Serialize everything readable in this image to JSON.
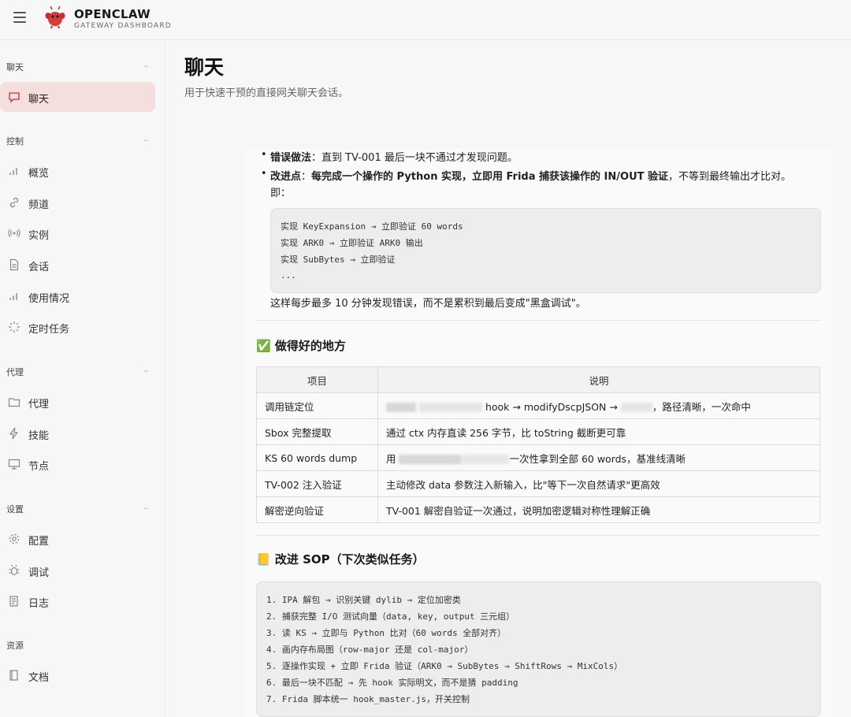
{
  "header": {
    "brand_title": "OPENCLAW",
    "brand_subtitle": "GATEWAY DASHBOARD"
  },
  "sidebar": {
    "sections": [
      {
        "title": "聊天",
        "items": [
          {
            "label": "聊天",
            "icon": "chat-icon",
            "active": true
          }
        ]
      },
      {
        "title": "控制",
        "items": [
          {
            "label": "概览",
            "icon": "bar-chart-icon"
          },
          {
            "label": "频道",
            "icon": "link-icon"
          },
          {
            "label": "实例",
            "icon": "broadcast-icon"
          },
          {
            "label": "会话",
            "icon": "document-icon"
          },
          {
            "label": "使用情况",
            "icon": "bar-chart-icon"
          },
          {
            "label": "定时任务",
            "icon": "loader-icon"
          }
        ]
      },
      {
        "title": "代理",
        "items": [
          {
            "label": "代理",
            "icon": "folder-icon"
          },
          {
            "label": "技能",
            "icon": "bolt-icon"
          },
          {
            "label": "节点",
            "icon": "monitor-icon"
          }
        ]
      },
      {
        "title": "设置",
        "items": [
          {
            "label": "配置",
            "icon": "gear-icon"
          },
          {
            "label": "调试",
            "icon": "bug-icon"
          },
          {
            "label": "日志",
            "icon": "log-icon"
          }
        ]
      },
      {
        "title": "资源",
        "items": [
          {
            "label": "文档",
            "icon": "book-icon"
          }
        ]
      }
    ],
    "collapse_symbol": "–"
  },
  "main": {
    "title": "聊天",
    "subtitle": "用于快速干预的直接网关聊天会话。"
  },
  "message": {
    "bullet1_label": "错误做法",
    "bullet1_text": "：直到 TV-001 最后一块不通过才发现问题。",
    "bullet2_label": "改进点",
    "bullet2_sep": "：",
    "bullet2_bold": "每完成一个操作的 Python 实现，立即用 Frida 捕获该操作的 IN/OUT 验证",
    "bullet2_rest": "，不等到最终输出才比对。",
    "bullet2_cont": "即：",
    "code1": [
      "实现 KeyExpansion → 立即验证 60 words",
      "实现 ARK0 → 立即验证 ARK0 输出",
      "实现 SubBytes → 立即验证",
      "..."
    ],
    "after_code": "这样每步最多 10 分钟发现错误，而不是累积到最后变成\"黑盒调试\"。",
    "heading_good": "✅ 做得好的地方",
    "table": {
      "headers": [
        "项目",
        "说明"
      ],
      "rows": [
        [
          "调用链定位",
          "hook → modifyDscpJSON → ",
          "，路径清晰，一次命中"
        ],
        [
          "Sbox 完整提取",
          "通过 ctx 内存直读 256 字节，比 toString 截断更可靠"
        ],
        [
          "KS 60 words dump",
          "用 ",
          "一次性拿到全部 60 words，基准线清晰"
        ],
        [
          "TV-002 注入验证",
          "主动修改 data 参数注入新输入，比\"等下一次自然请求\"更高效"
        ],
        [
          "解密逆向验证",
          "TV-001 解密自验证一次通过，说明加密逻辑对称性理解正确"
        ]
      ]
    },
    "heading_sop": "📒 改进 SOP（下次类似任务）",
    "code2": [
      "1. IPA 解包 → 识别关键 dylib → 定位加密类",
      "2. 捕获完整 I/O 测试向量（data, key, output 三元组）",
      "3. 读 KS → 立即与 Python 比对（60 words 全部对齐）",
      "4. 画内存布局图（row-major 还是 col-major）",
      "5. 逐操作实现 + 立即 Frida 验证（ARK0 → SubBytes → ShiftRows → MixCols）",
      "6. 最后一块不匹配 → 先 hook 实际明文，而不是猜 padding",
      "7. Frida 脚本统一 hook_master.js，开关控制"
    ]
  }
}
